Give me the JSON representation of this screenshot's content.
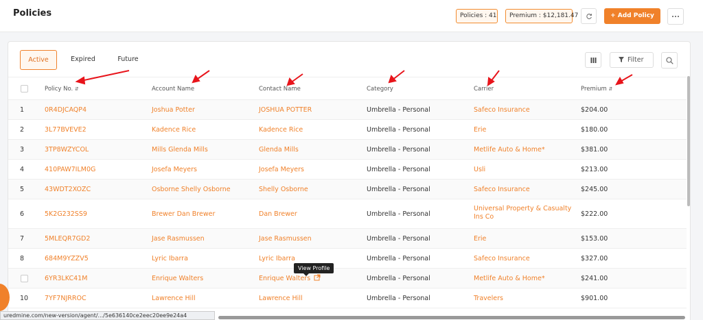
{
  "header": {
    "title": "Policies",
    "policies_badge": "Policies : 41",
    "premium_badge": "Premium : $12,181.47",
    "add_button": "+ Add Policy"
  },
  "tabs": [
    "Active",
    "Expired",
    "Future"
  ],
  "toolbar": {
    "filter_label": "Filter"
  },
  "columns": [
    "Policy No.",
    "Account Name",
    "Contact Name",
    "Category",
    "Carrier",
    "Premium"
  ],
  "rows": [
    {
      "n": "1",
      "policy": "0R4DJCAQP4",
      "account": "Joshua Potter",
      "contact": "JOSHUA POTTER",
      "category": "Umbrella - Personal",
      "carrier": "Safeco Insurance",
      "premium": "$204.00"
    },
    {
      "n": "2",
      "policy": "3L77BVEVE2",
      "account": "Kadence Rice",
      "contact": "Kadence Rice",
      "category": "Umbrella - Personal",
      "carrier": "Erie",
      "premium": "$180.00"
    },
    {
      "n": "3",
      "policy": "3TP8WZYCOL",
      "account": "Mills Glenda Mills",
      "contact": "Glenda Mills",
      "category": "Umbrella - Personal",
      "carrier": "Metlife Auto & Home*",
      "premium": "$381.00"
    },
    {
      "n": "4",
      "policy": "410PAW7ILM0G",
      "account": "Josefa Meyers",
      "contact": "Josefa Meyers",
      "category": "Umbrella - Personal",
      "carrier": "Usli",
      "premium": "$213.00"
    },
    {
      "n": "5",
      "policy": "43WDT2XOZC",
      "account": "Osborne Shelly Osborne",
      "contact": "Shelly Osborne",
      "category": "Umbrella - Personal",
      "carrier": "Safeco Insurance",
      "premium": "$245.00"
    },
    {
      "n": "6",
      "policy": "5K2G232SS9",
      "account": "Brewer Dan Brewer",
      "contact": "Dan Brewer",
      "category": "Umbrella - Personal",
      "carrier": "Universal Property & Casualty Ins Co",
      "premium": "$222.00"
    },
    {
      "n": "7",
      "policy": "5MLEQR7GD2",
      "account": "Jase Rasmussen",
      "contact": "Jase Rasmussen",
      "category": "Umbrella - Personal",
      "carrier": "Erie",
      "premium": "$153.00"
    },
    {
      "n": "8",
      "policy": "684M9YZZV5",
      "account": "Lyric Ibarra",
      "contact": "Lyric Ibarra",
      "category": "Umbrella - Personal",
      "carrier": "Safeco Insurance",
      "premium": "$327.00"
    },
    {
      "n": "",
      "policy": "6YR3LKC41M",
      "account": "Enrique Walters",
      "contact": "Enrique Walters",
      "category": "Umbrella - Personal",
      "carrier": "Metlife Auto & Home*",
      "premium": "$241.00"
    },
    {
      "n": "10",
      "policy": "7YF7NJRROC",
      "account": "Lawrence Hill",
      "contact": "Lawrence Hill",
      "category": "Umbrella - Personal",
      "carrier": "Travelers",
      "premium": "$901.00"
    }
  ],
  "tooltip": "View Profile",
  "status_url": "uredmine.com/new-version/agent/.../5e636140ce2eec20ee9e24a4",
  "colors": {
    "accent": "#f0812a",
    "annotation": "#e8141b"
  }
}
